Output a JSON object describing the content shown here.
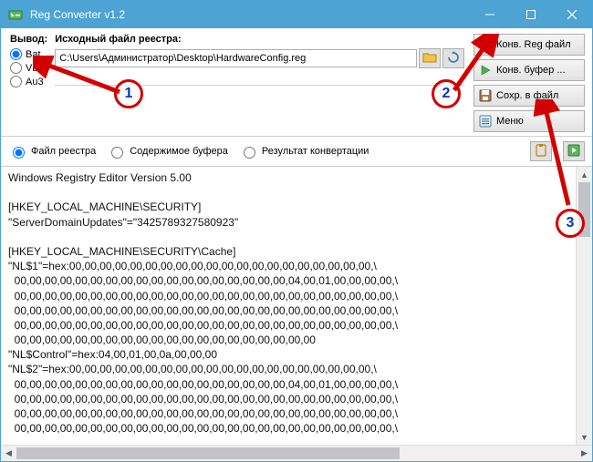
{
  "title": "Reg Converter v1.2",
  "output": {
    "label": "Вывод:",
    "opts": [
      "Bat",
      "Vbs",
      "Au3"
    ],
    "selected": 0
  },
  "source": {
    "label": "Исходный файл реестра:",
    "path": "C:\\Users\\Администратор\\Desktop\\HardwareConfig.reg"
  },
  "buttons": {
    "convReg": "Конв. Reg файл",
    "convBuf": "Конв. буфер ...",
    "save": "Сохр. в файл",
    "menu": "Меню"
  },
  "viewOpts": {
    "file": "Файл реестра",
    "buffer": "Содержимое буфера",
    "result": "Результат конвертации",
    "selected": 0
  },
  "regText": "Windows Registry Editor Version 5.00\n\n[HKEY_LOCAL_MACHINE\\SECURITY]\n\"ServerDomainUpdates\"=\"3425789327580923\"\n\n[HKEY_LOCAL_MACHINE\\SECURITY\\Cache]\n\"NL$1\"=hex:00,00,00,00,00,00,00,00,00,00,00,00,00,00,00,00,00,00,00,00,\\\n  00,00,00,00,00,00,00,00,00,00,00,00,00,00,00,00,00,00,04,00,01,00,00,00,00,\\\n  00,00,00,00,00,00,00,00,00,00,00,00,00,00,00,00,00,00,00,00,00,00,00,00,00,\\\n  00,00,00,00,00,00,00,00,00,00,00,00,00,00,00,00,00,00,00,00,00,00,00,00,00,\\\n  00,00,00,00,00,00,00,00,00,00,00,00,00,00,00,00,00,00,00,00,00,00,00,00,00,\\\n  00,00,00,00,00,00,00,00,00,00,00,00,00,00,00,00,00,00,00,00\n\"NL$Control\"=hex:04,00,01,00,0a,00,00,00\n\"NL$2\"=hex:00,00,00,00,00,00,00,00,00,00,00,00,00,00,00,00,00,00,00,00,\\\n  00,00,00,00,00,00,00,00,00,00,00,00,00,00,00,00,00,00,04,00,01,00,00,00,00,\\\n  00,00,00,00,00,00,00,00,00,00,00,00,00,00,00,00,00,00,00,00,00,00,00,00,00,\\\n  00,00,00,00,00,00,00,00,00,00,00,00,00,00,00,00,00,00,00,00,00,00,00,00,00,\\\n  00,00,00,00,00,00,00,00,00,00,00,00,00,00,00,00,00,00,00,00,00,00,00,00,00,\\",
  "annotations": {
    "c1": "1",
    "c2": "2",
    "c3": "3"
  }
}
